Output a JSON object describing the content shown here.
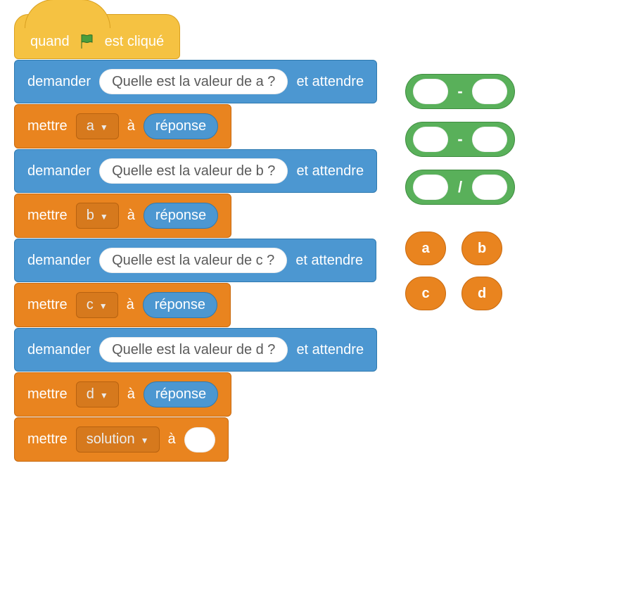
{
  "hat": {
    "prefix": "quand",
    "suffix": "est cliqué"
  },
  "blocks": [
    {
      "kind": "ask",
      "prefix": "demander",
      "prompt": "Quelle est la valeur de a ?",
      "suffix": "et attendre"
    },
    {
      "kind": "set",
      "prefix": "mettre",
      "var": "a",
      "mid": "à",
      "value": "réponse"
    },
    {
      "kind": "ask",
      "prefix": "demander",
      "prompt": "Quelle est la valeur de b ?",
      "suffix": "et attendre"
    },
    {
      "kind": "set",
      "prefix": "mettre",
      "var": "b",
      "mid": "à",
      "value": "réponse"
    },
    {
      "kind": "ask",
      "prefix": "demander",
      "prompt": "Quelle est la valeur de c ?",
      "suffix": "et attendre"
    },
    {
      "kind": "set",
      "prefix": "mettre",
      "var": "c",
      "mid": "à",
      "value": "réponse"
    },
    {
      "kind": "ask",
      "prefix": "demander",
      "prompt": "Quelle est la valeur de d ?",
      "suffix": "et attendre"
    },
    {
      "kind": "set",
      "prefix": "mettre",
      "var": "d",
      "mid": "à",
      "value": "réponse"
    },
    {
      "kind": "set-empty",
      "prefix": "mettre",
      "var": "solution",
      "mid": "à"
    }
  ],
  "operators": [
    {
      "symbol": "-"
    },
    {
      "symbol": "-"
    },
    {
      "symbol": "/"
    }
  ],
  "variables": [
    "a",
    "b",
    "c",
    "d"
  ]
}
